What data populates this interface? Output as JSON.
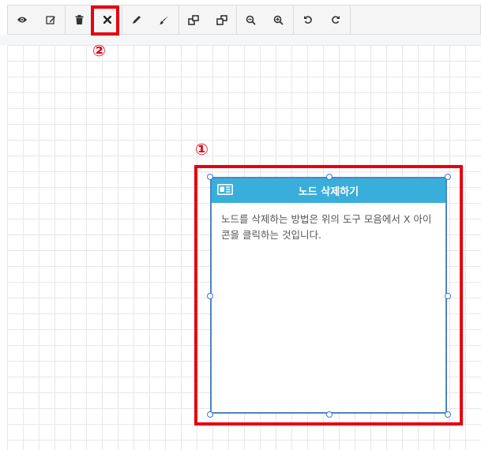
{
  "toolbar": {
    "buttons": [
      {
        "icon": "eye-icon",
        "title": "preview"
      },
      {
        "icon": "edit-icon",
        "title": "edit"
      },
      {
        "icon": "trash-icon",
        "title": "delete"
      },
      {
        "icon": "close-icon",
        "title": "remove"
      },
      {
        "icon": "pencil-icon",
        "title": "draw"
      },
      {
        "icon": "brush-icon",
        "title": "style"
      },
      {
        "icon": "bring-front-icon",
        "title": "bring to front"
      },
      {
        "icon": "send-back-icon",
        "title": "send to back"
      },
      {
        "icon": "zoom-out-icon",
        "title": "zoom out"
      },
      {
        "icon": "zoom-in-icon",
        "title": "zoom in"
      },
      {
        "icon": "undo-icon",
        "title": "undo"
      },
      {
        "icon": "redo-icon",
        "title": "redo"
      }
    ]
  },
  "node": {
    "title": "노드 삭제하기",
    "body": "노드를 삭제하는 방법은 위의 도구 모음에서 X 아이콘을 클릭하는 것입니다.",
    "header_color": "#39aedb",
    "border_color": "#4a86c8"
  },
  "annotations": {
    "node_marker": "①",
    "delete_marker": "②",
    "highlight_color": "#e60012"
  }
}
